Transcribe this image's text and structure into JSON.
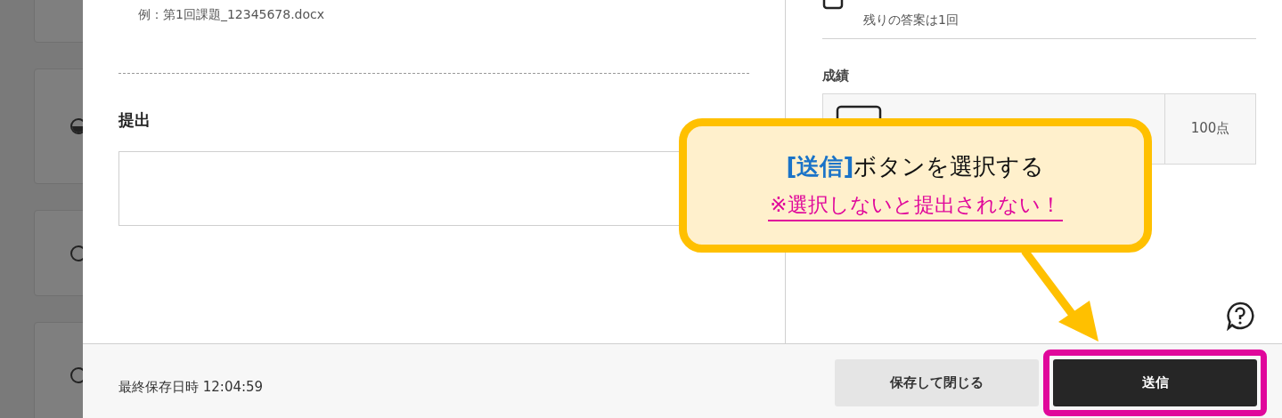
{
  "background_options": [
    {
      "selected": true
    },
    {
      "selected": false
    },
    {
      "selected": false
    }
  ],
  "submission": {
    "filename_example": "例：第1回課題_12345678.docx",
    "heading": "提出"
  },
  "attempts": {
    "remaining": "残りの答案は1回"
  },
  "grade": {
    "label": "成績",
    "points": "100点"
  },
  "footer": {
    "last_saved": "最終保存日時 12:04:59",
    "buttons": [
      {
        "kind": "secondary",
        "label": "保存して閉じる",
        "highlighted": false
      },
      {
        "kind": "primary",
        "label": "送信",
        "highlighted": true
      }
    ]
  },
  "callout": {
    "emphasis": "[送信]",
    "text": "ボタンを選択する",
    "warning": "※選択しないと提出されない！"
  }
}
